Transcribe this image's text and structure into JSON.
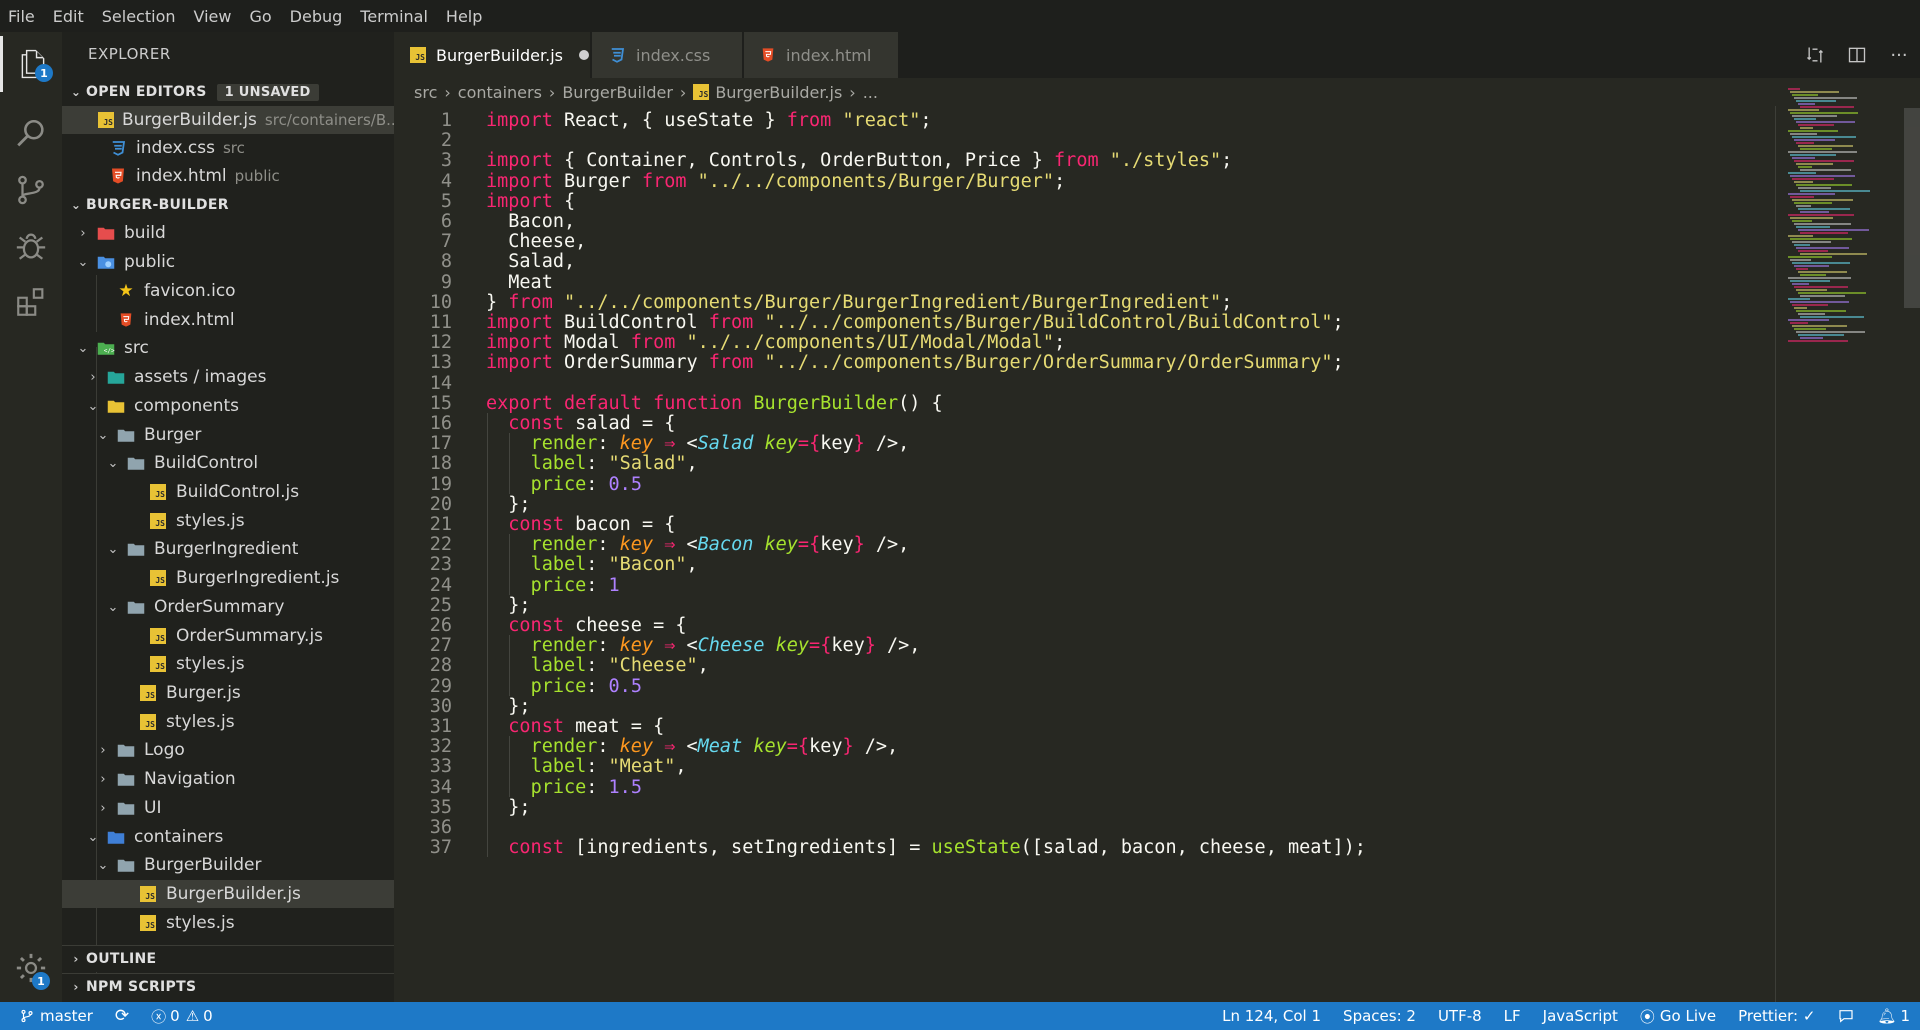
{
  "menu": [
    "File",
    "Edit",
    "Selection",
    "View",
    "Go",
    "Debug",
    "Terminal",
    "Help"
  ],
  "activity": {
    "explorer_badge": "1",
    "settings_badge": "1"
  },
  "sidebar": {
    "title": "EXPLORER",
    "open_editors": {
      "header": "OPEN EDITORS",
      "badge": "1 UNSAVED",
      "items": [
        {
          "name": "BurgerBuilder.js",
          "desc": "src/containers/B..."
        },
        {
          "name": "index.css",
          "desc": "src"
        },
        {
          "name": "index.html",
          "desc": "public"
        }
      ]
    },
    "project": {
      "header": "BURGER-BUILDER",
      "tree": [
        "build",
        "public",
        "favicon.ico",
        "index.html",
        "src",
        "assets / images",
        "components",
        "Burger",
        "BuildControl",
        "BuildControl.js",
        "styles.js",
        "BurgerIngredient",
        "BurgerIngredient.js",
        "OrderSummary",
        "OrderSummary.js",
        "styles.js",
        "Burger.js",
        "styles.js",
        "Logo",
        "Navigation",
        "UI",
        "containers",
        "BurgerBuilder",
        "BurgerBuilder.js",
        "styles.js"
      ]
    },
    "outline": "OUTLINE",
    "npm_scripts": "NPM SCRIPTS"
  },
  "tabs": [
    {
      "label": "BurgerBuilder.js",
      "icon": "js-icon",
      "active": true
    },
    {
      "label": "index.css",
      "icon": "css-icon",
      "active": false
    },
    {
      "label": "index.html",
      "icon": "html-icon",
      "active": false
    }
  ],
  "breadcrumb": [
    "src",
    "containers",
    "BurgerBuilder",
    "BurgerBuilder.js",
    "..."
  ],
  "code": {
    "line_numbers": [
      "1",
      "2",
      "3",
      "4",
      "5",
      "6",
      "7",
      "8",
      "9",
      "10",
      "11",
      "12",
      "13",
      "14",
      "15",
      "16",
      "17",
      "18",
      "19",
      "20",
      "21",
      "22",
      "23",
      "24",
      "25",
      "26",
      "27",
      "28",
      "29",
      "30",
      "31",
      "32",
      "33",
      "34",
      "35",
      "36",
      "37"
    ],
    "lines": [
      "import React, { useState } from \"react\";",
      "",
      "import { Container, Controls, OrderButton, Price } from \"./styles\";",
      "import Burger from \"../../components/Burger/Burger\";",
      "import {",
      "  Bacon,",
      "  Cheese,",
      "  Salad,",
      "  Meat",
      "} from \"../../components/Burger/BurgerIngredient/BurgerIngredient\";",
      "import BuildControl from \"../../components/Burger/BuildControl/BuildControl\";",
      "import Modal from \"../../components/UI/Modal/Modal\";",
      "import OrderSummary from \"../../components/Burger/OrderSummary/OrderSummary\";",
      "",
      "export default function BurgerBuilder() {",
      "  const salad = {",
      "    render: key => <Salad key={key} />,",
      "    label: \"Salad\",",
      "    price: 0.5",
      "  };",
      "  const bacon = {",
      "    render: key => <Bacon key={key} />,",
      "    label: \"Bacon\",",
      "    price: 1",
      "  };",
      "  const cheese = {",
      "    render: key => <Cheese key={key} />,",
      "    label: \"Cheese\",",
      "    price: 0.5",
      "  };",
      "  const meat = {",
      "    render: key => <Meat key={key} />,",
      "    label: \"Meat\",",
      "    price: 1.5",
      "  };",
      "",
      "  const [ingredients, setIngredients] = useState([salad, bacon, cheese, meat]);"
    ]
  },
  "status": {
    "branch": "master",
    "errors": "0",
    "warnings": "0",
    "position": "Ln 124, Col 1",
    "spaces": "Spaces: 2",
    "encoding": "UTF-8",
    "eol": "LF",
    "language": "JavaScript",
    "golive": "Go Live",
    "prettier": "Prettier: ✓",
    "bell_count": "1"
  },
  "colors": {
    "statusbar": "#1e79c7",
    "editor_bg": "#272822",
    "keyword": "#f92672",
    "string": "#e6db74",
    "function": "#a6e22e",
    "number": "#ae81ff"
  }
}
